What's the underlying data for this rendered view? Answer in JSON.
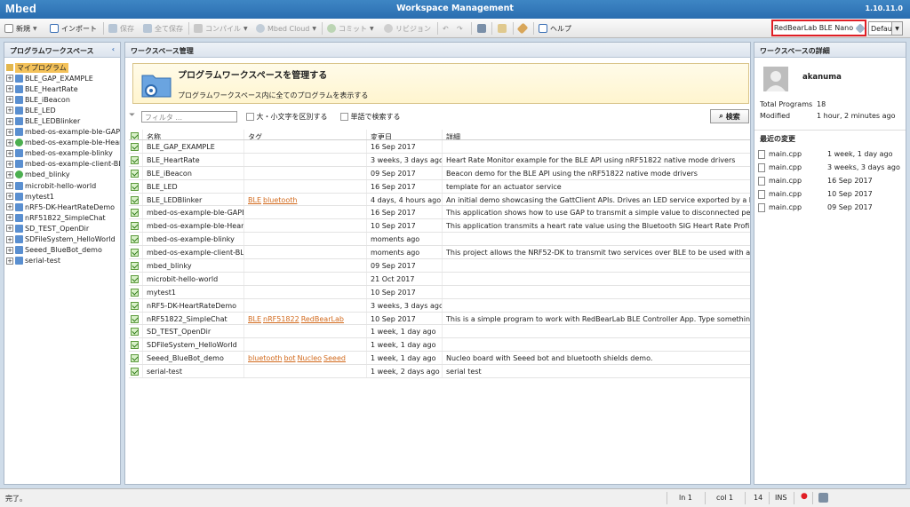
{
  "app": {
    "logo": "Mbed",
    "title": "Workspace Management",
    "version": "1.10.11.0"
  },
  "toolbar": {
    "new_label": "新規",
    "import_label": "インポート",
    "save_label": "保存",
    "save_all_label": "全て保存",
    "compile_label": "コンパイル",
    "mbed_cloud_label": "Mbed Cloud",
    "commit_label": "コミット",
    "revision_label": "リビジョン",
    "help_label": "ヘルプ",
    "target_label": "RedBearLab BLE Nano",
    "default_label": "Default"
  },
  "left_panel": {
    "title": "プログラムワークスペース",
    "root_label": "マイプログラム",
    "items": [
      {
        "label": "BLE_GAP_EXAMPLE",
        "icon": "folder-icon"
      },
      {
        "label": "BLE_HeartRate",
        "icon": "folder-icon"
      },
      {
        "label": "BLE_iBeacon",
        "icon": "folder-icon"
      },
      {
        "label": "BLE_LED",
        "icon": "folder-icon"
      },
      {
        "label": "BLE_LEDBlinker",
        "icon": "folder-icon"
      },
      {
        "label": "mbed-os-example-ble-GAPButton",
        "icon": "folder-icon"
      },
      {
        "label": "mbed-os-example-ble-HeartRate",
        "icon": "folder-green-icon"
      },
      {
        "label": "mbed-os-example-blinky",
        "icon": "folder-icon"
      },
      {
        "label": "mbed-os-example-client-BLE-N",
        "icon": "folder-icon"
      },
      {
        "label": "mbed_blinky",
        "icon": "folder-green-icon"
      },
      {
        "label": "microbit-hello-world",
        "icon": "folder-icon"
      },
      {
        "label": "mytest1",
        "icon": "folder-icon"
      },
      {
        "label": "nRF5-DK-HeartRateDemo",
        "icon": "folder-icon"
      },
      {
        "label": "nRF51822_SimpleChat",
        "icon": "folder-icon"
      },
      {
        "label": "SD_TEST_OpenDir",
        "icon": "folder-icon"
      },
      {
        "label": "SDFileSystem_HelloWorld",
        "icon": "folder-icon"
      },
      {
        "label": "Seeed_BlueBot_demo",
        "icon": "folder-icon"
      },
      {
        "label": "serial-test",
        "icon": "folder-icon"
      }
    ]
  },
  "center": {
    "panel_title": "ワークスペース管理",
    "banner_title": "プログラムワークスペースを管理する",
    "banner_subtitle": "プログラムワークスペース内に全てのプログラムを表示する",
    "filter_placeholder": "フィルタ ...",
    "case_label": "大・小文字を区別する",
    "word_label": "単語で検索する",
    "search_label": "検索",
    "columns": [
      "名称",
      "タグ",
      "変更日",
      "詳細"
    ],
    "rows": [
      {
        "name": "BLE_GAP_EXAMPLE",
        "tags": [],
        "date": "16 Sep 2017",
        "desc": ""
      },
      {
        "name": "BLE_HeartRate",
        "tags": [],
        "date": "3 weeks, 3 days ago",
        "desc": "Heart Rate Monitor example for the BLE API using nRF51822 native mode drivers"
      },
      {
        "name": "BLE_iBeacon",
        "tags": [],
        "date": "09 Sep 2017",
        "desc": "Beacon demo for the BLE API using the nRF51822 native mode drivers"
      },
      {
        "name": "BLE_LED",
        "tags": [],
        "date": "16 Sep 2017",
        "desc": "template for an actuator service"
      },
      {
        "name": "BLE_LEDBlinker",
        "tags": [
          "BLE",
          "bluetooth"
        ],
        "date": "4 days, 4 hours ago",
        "desc": "An initial demo showcasing the GattClient APIs. Drives an LED service exported by a BLE_LED peripheral"
      },
      {
        "name": "mbed-os-example-ble-GAPButton",
        "tags": [],
        "date": "16 Sep 2017",
        "desc": "This application shows how to use GAP to transmit a simple value to disconnected peer listening for"
      },
      {
        "name": "mbed-os-example-ble-HeartRate",
        "tags": [],
        "date": "10 Sep 2017",
        "desc": "This application transmits a heart rate value using the Bluetooth SIG Heart Rate Profile. The heart rate"
      },
      {
        "name": "mbed-os-example-blinky",
        "tags": [],
        "date": "moments ago",
        "desc": ""
      },
      {
        "name": "mbed-os-example-client-BLE-NRF",
        "tags": [],
        "date": "moments ago",
        "desc": "This project allows the NRF52-DK to transmit two services over BLE to be used with a BLE gateway"
      },
      {
        "name": "mbed_blinky",
        "tags": [],
        "date": "09 Sep 2017",
        "desc": ""
      },
      {
        "name": "microbit-hello-world",
        "tags": [],
        "date": "21 Oct 2017",
        "desc": ""
      },
      {
        "name": "mytest1",
        "tags": [],
        "date": "10 Sep 2017",
        "desc": ""
      },
      {
        "name": "nRF5-DK-HeartRateDemo",
        "tags": [],
        "date": "3 weeks, 3 days ago",
        "desc": ""
      },
      {
        "name": "nRF51822_SimpleChat",
        "tags": [
          "BLE",
          "nRF51822",
          "RedBearLab"
        ],
        "date": "10 Sep 2017",
        "desc": "This is a simple program to work with RedBearLab BLE Controller App. Type something from the Terminal"
      },
      {
        "name": "SD_TEST_OpenDir",
        "tags": [],
        "date": "1 week, 1 day ago",
        "desc": ""
      },
      {
        "name": "SDFileSystem_HelloWorld",
        "tags": [],
        "date": "1 week, 1 day ago",
        "desc": ""
      },
      {
        "name": "Seeed_BlueBot_demo",
        "tags": [
          "bluetooth",
          "bot",
          "Nucleo",
          "Seeed"
        ],
        "date": "1 week, 1 day ago",
        "desc": "Nucleo board with Seeed bot and bluetooth shields demo."
      },
      {
        "name": "serial-test",
        "tags": [],
        "date": "1 week, 2 days ago",
        "desc": "serial test"
      }
    ]
  },
  "right_panel": {
    "title": "ワークスペースの詳細",
    "username": "akanuma",
    "total_label": "Total Programs",
    "total_value": "18",
    "modified_label": "Modified",
    "modified_value": "1 hour, 2 minutes ago",
    "recent_title": "最近の変更",
    "recent": [
      {
        "file": "main.cpp",
        "when": "1 week, 1 day ago"
      },
      {
        "file": "main.cpp",
        "when": "3 weeks, 3 days ago"
      },
      {
        "file": "main.cpp",
        "when": "16 Sep 2017"
      },
      {
        "file": "main.cpp",
        "when": "10 Sep 2017"
      },
      {
        "file": "main.cpp",
        "when": "09 Sep 2017"
      }
    ]
  },
  "status": {
    "message": "完了。",
    "line": "ln 1",
    "col": "col 1",
    "num": "14",
    "ins": "INS"
  },
  "colors": {
    "topbar": "#2f74b5",
    "tag": "#d26a1d",
    "highlight": "#f4c25a",
    "target_border": "#e01e25"
  }
}
